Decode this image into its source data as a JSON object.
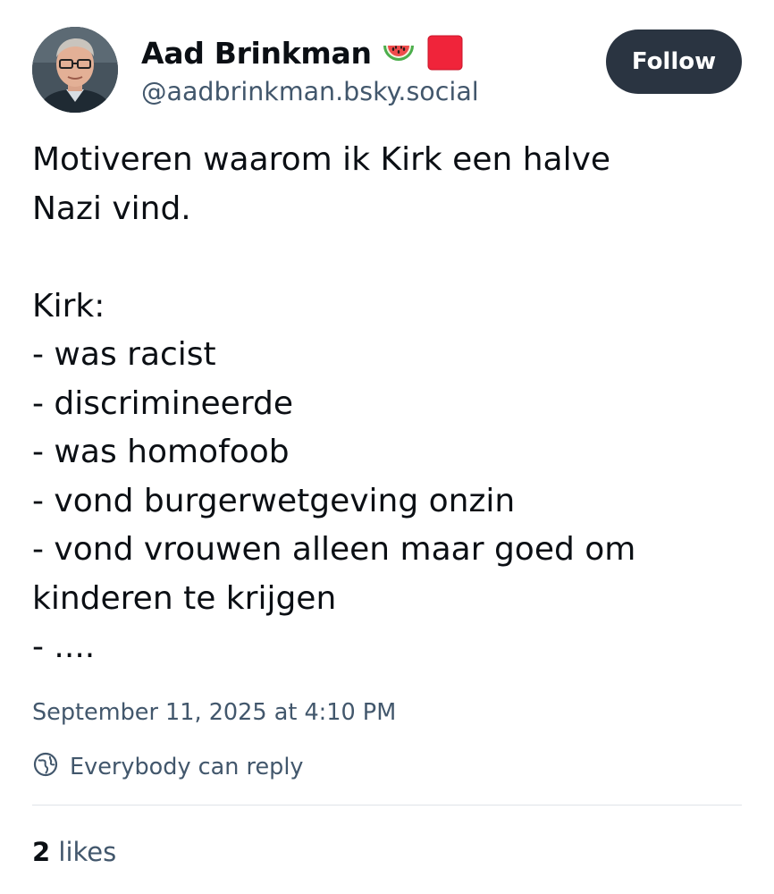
{
  "author": {
    "display_name": "Aad Brinkman",
    "name_emojis": [
      "watermelon-icon",
      "red-square-icon"
    ],
    "handle": "@aadbrinkman.bsky.social"
  },
  "follow_button": {
    "label": "Follow"
  },
  "post": {
    "lines": [
      "Motiveren waarom ik Kirk een halve",
      "Nazi vind.",
      "",
      "Kirk:",
      "- was racist",
      "- discrimineerde",
      "- was homofoob",
      "- vond burgerwetgeving onzin",
      "- vond vrouwen alleen maar goed om",
      "kinderen te krijgen",
      "- ...."
    ]
  },
  "meta": {
    "timestamp": "September 11, 2025 at 4:10 PM",
    "reply_setting": "Everybody can reply",
    "reply_icon": "globe-icon"
  },
  "stats": {
    "likes_count": "2",
    "likes_label": "likes"
  },
  "colors": {
    "primary_text": "#0b0f14",
    "secondary_text": "#42576c",
    "follow_bg": "#2a3441",
    "divider": "#dfe3e8"
  }
}
